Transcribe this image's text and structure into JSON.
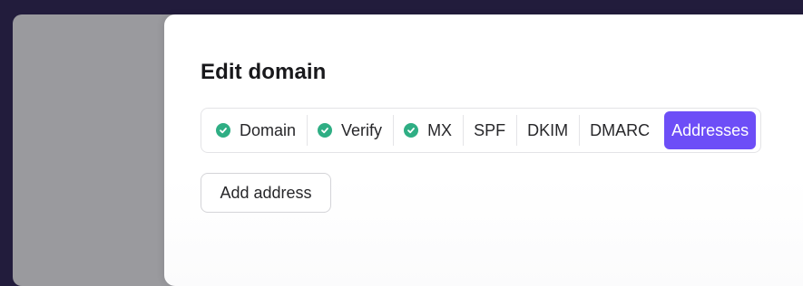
{
  "modal": {
    "title": "Edit domain"
  },
  "steps": {
    "items": [
      {
        "label": "Domain",
        "completed": true,
        "active": false
      },
      {
        "label": "Verify",
        "completed": true,
        "active": false
      },
      {
        "label": "MX",
        "completed": true,
        "active": false
      },
      {
        "label": "SPF",
        "completed": false,
        "active": false
      },
      {
        "label": "DKIM",
        "completed": false,
        "active": false
      },
      {
        "label": "DMARC",
        "completed": false,
        "active": false
      },
      {
        "label": "Addresses",
        "completed": false,
        "active": true
      }
    ],
    "check_icon": "check-circle-icon",
    "completed_color": "#2fae84",
    "active_color": "#6d4ef7"
  },
  "actions": {
    "add_address_label": "Add address"
  }
}
